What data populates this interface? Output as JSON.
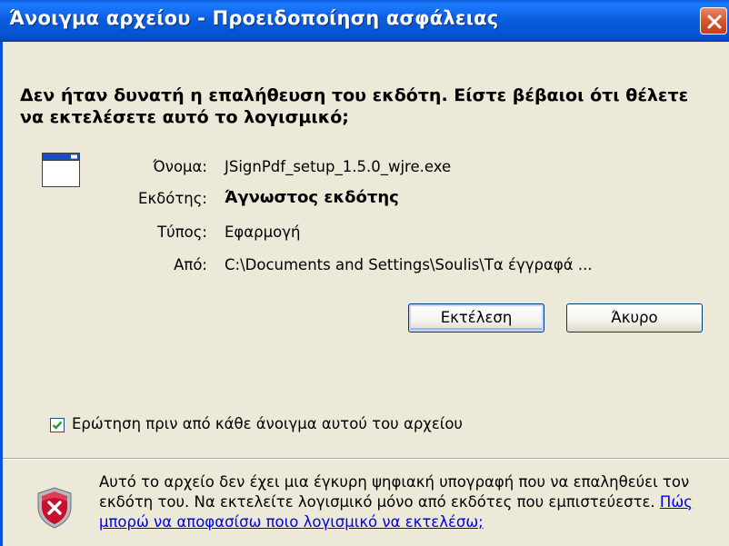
{
  "window": {
    "title": "Άνοιγμα αρχείου - Προειδοποίηση ασφάλειας",
    "close_label": "X"
  },
  "message": {
    "headline": "Δεν ήταν δυνατή η επαλήθευση του εκδότη. Είστε βέβαιοι ότι θέλετε να εκτελέσετε αυτό το λογισμικό;"
  },
  "fields": {
    "name_label": "Όνομα:",
    "name_value": "JSignPdf_setup_1.5.0_wjre.exe",
    "publisher_label": "Εκδότης:",
    "publisher_value": "Άγνωστος εκδότης",
    "type_label": "Τύπος:",
    "type_value": "Εφαρμογή",
    "from_label": "Από:",
    "from_value": "C:\\Documents and Settings\\Soulis\\Τα έγγραφά ..."
  },
  "buttons": {
    "run": "Εκτέλεση",
    "cancel": "Άκυρο"
  },
  "checkbox": {
    "label": "Ερώτηση πριν από κάθε άνοιγμα αυτού του αρχείου",
    "checked": true
  },
  "warning": {
    "text": "Αυτό το αρχείο δεν έχει μια έγκυρη ψηφιακή υπογραφή που να επαληθεύει τον εκδότη του. Να εκτελείτε λογισμικό μόνο από εκδότες που εμπιστεύεστε. ",
    "link": "Πώς μπορώ να αποφασίσω ποιο λογισμικό να εκτελέσω;"
  },
  "icons": {
    "app": "application-window-icon",
    "shield": "security-shield-icon",
    "close": "close-icon",
    "check": "check-icon"
  },
  "colors": {
    "title_bar": "#0a5ee0",
    "close_button": "#d5512c",
    "dialog_bg": "#ece9d8",
    "link": "#0000ee",
    "shield_red": "#c8102e"
  }
}
